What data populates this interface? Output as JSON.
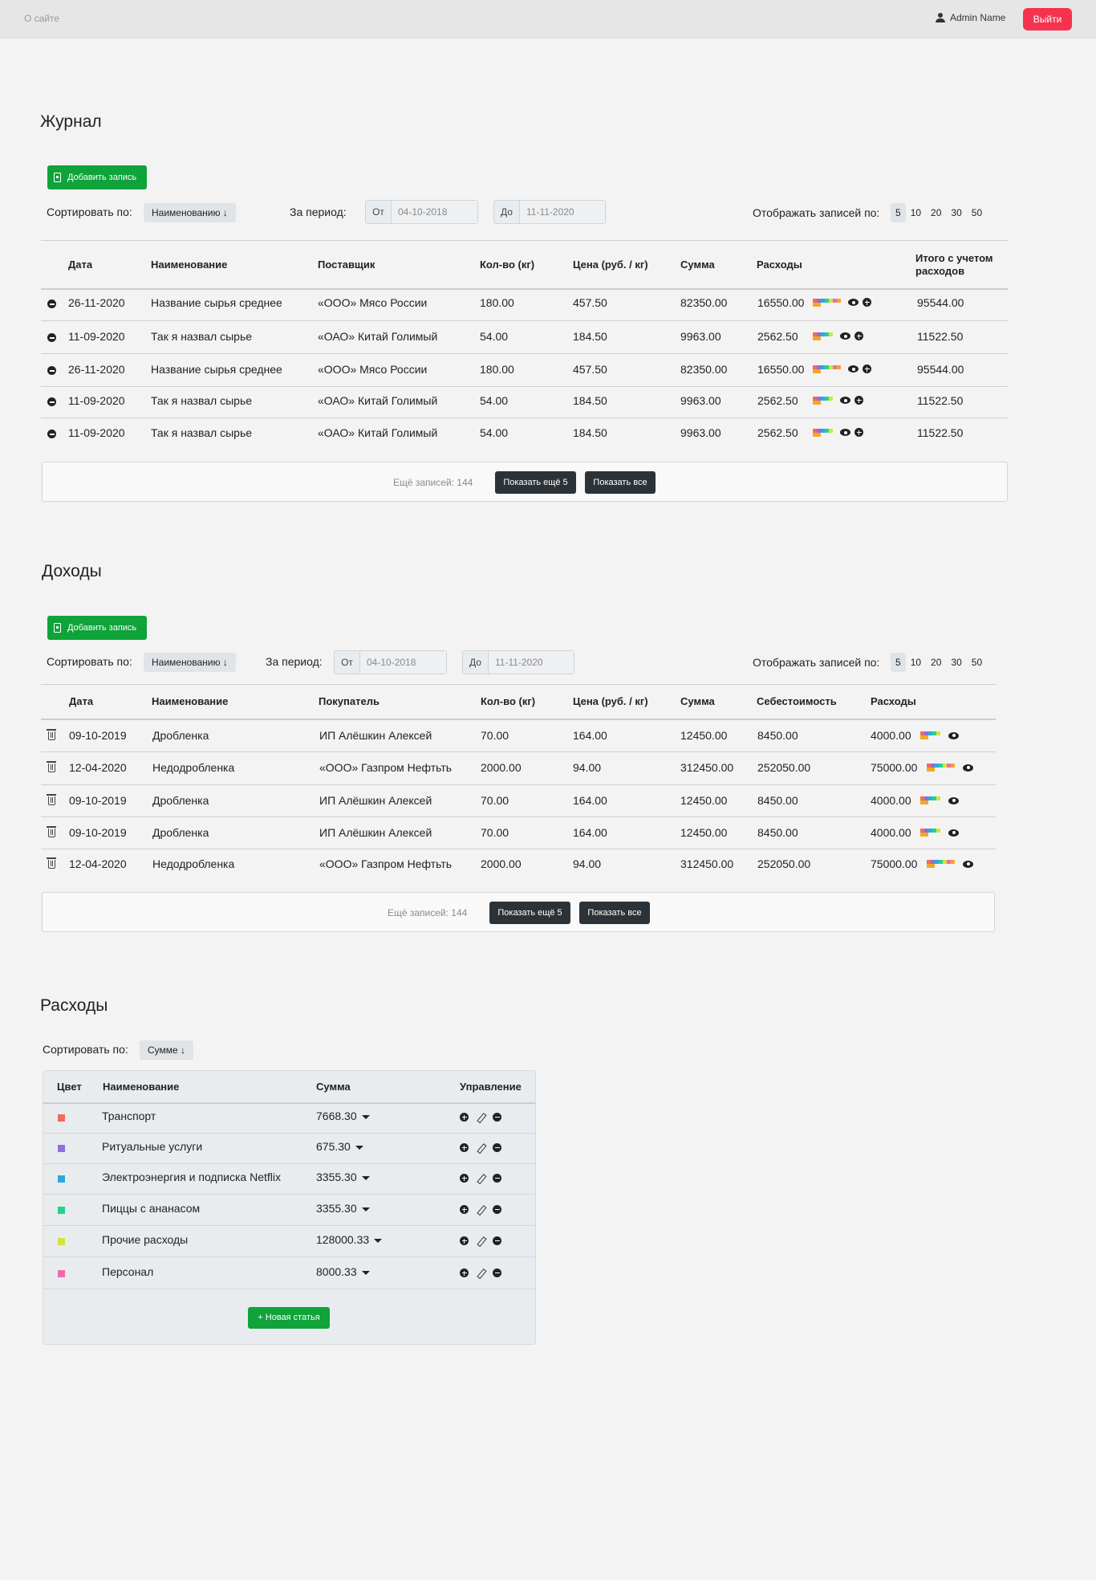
{
  "topbar": {
    "about": "О сайте",
    "user_name": "Admin Name",
    "logout": "Выйти"
  },
  "journal": {
    "title": "Журнал",
    "add_label": "Добавить запись",
    "sort_label": "Сортировать по:",
    "sort_value": "Наименованию ↓",
    "period_label": "За период:",
    "from_prefix": "От",
    "from_value": "04-10-2018",
    "to_prefix": "До",
    "to_value": "11-11-2020",
    "page_size_label": "Отображать записей по:",
    "page_sizes": [
      "5",
      "10",
      "20",
      "30",
      "50"
    ],
    "headers": [
      "Дата",
      "Наименование",
      "Поставщик",
      "Кол-во (кг)",
      "Цена (руб. / кг)",
      "Сумма",
      "Расходы",
      "Итого с учетом расходов"
    ],
    "rows": [
      {
        "date": "26-11-2020",
        "name": "Название сырья среднее",
        "supplier": "«ООО» Мясо России",
        "qty": "180.00",
        "price": "457.50",
        "sum": "82350.00",
        "expenses": "16550.00",
        "total": "95544.00"
      },
      {
        "date": "11-09-2020",
        "name": "Так я назвал сырье",
        "supplier": "«ОАО» Китай Голимый",
        "qty": "54.00",
        "price": "184.50",
        "sum": "9963.00",
        "expenses": "2562.50",
        "total": "11522.50"
      },
      {
        "date": "26-11-2020",
        "name": "Название сырья среднее",
        "supplier": "«ООО» Мясо России",
        "qty": "180.00",
        "price": "457.50",
        "sum": "82350.00",
        "expenses": "16550.00",
        "total": "95544.00"
      },
      {
        "date": "11-09-2020",
        "name": "Так я назвал сырье",
        "supplier": "«ОАО» Китай Голимый",
        "qty": "54.00",
        "price": "184.50",
        "sum": "9963.00",
        "expenses": "2562.50",
        "total": "11522.50"
      },
      {
        "date": "11-09-2020",
        "name": "Так я назвал сырье",
        "supplier": "«ОАО» Китай Голимый",
        "qty": "54.00",
        "price": "184.50",
        "sum": "9963.00",
        "expenses": "2562.50",
        "total": "11522.50"
      }
    ],
    "more_text": "Ещё записей: 144",
    "show_more": "Показать ещё 5",
    "show_all": "Показать все"
  },
  "income": {
    "title": "Доходы",
    "add_label": "Добавить запись",
    "sort_label": "Сортировать по:",
    "sort_value": "Наименованию ↓",
    "period_label": "За период:",
    "from_prefix": "От",
    "from_value": "04-10-2018",
    "to_prefix": "До",
    "to_value": "11-11-2020",
    "page_size_label": "Отображать записей по:",
    "page_sizes": [
      "5",
      "10",
      "20",
      "30",
      "50"
    ],
    "headers": [
      "Дата",
      "Наименование",
      "Покупатель",
      "Кол-во (кг)",
      "Цена (руб. / кг)",
      "Сумма",
      "Себестоимость",
      "Расходы"
    ],
    "rows": [
      {
        "date": "09-10-2019",
        "name": "Дробленка",
        "buyer": "ИП Алёшкин Алексей",
        "qty": "70.00",
        "price": "164.00",
        "sum": "12450.00",
        "cost": "8450.00",
        "expenses": "4000.00"
      },
      {
        "date": "12-04-2020",
        "name": "Недодробленка",
        "buyer": "«ООО» Газпром Нефтьть",
        "qty": "2000.00",
        "price": "94.00",
        "sum": "312450.00",
        "cost": "252050.00",
        "expenses": "75000.00"
      },
      {
        "date": "09-10-2019",
        "name": "Дробленка",
        "buyer": "ИП Алёшкин Алексей",
        "qty": "70.00",
        "price": "164.00",
        "sum": "12450.00",
        "cost": "8450.00",
        "expenses": "4000.00"
      },
      {
        "date": "09-10-2019",
        "name": "Дробленка",
        "buyer": "ИП Алёшкин Алексей",
        "qty": "70.00",
        "price": "164.00",
        "sum": "12450.00",
        "cost": "8450.00",
        "expenses": "4000.00"
      },
      {
        "date": "12-04-2020",
        "name": "Недодробленка",
        "buyer": "«ООО» Газпром Нефтьть",
        "qty": "2000.00",
        "price": "94.00",
        "sum": "312450.00",
        "cost": "252050.00",
        "expenses": "75000.00"
      }
    ],
    "more_text": "Ещё записей: 144",
    "show_more": "Показать ещё 5",
    "show_all": "Показать все"
  },
  "expenses": {
    "title": "Расходы",
    "sort_label": "Сортировать по:",
    "sort_value": "Сумме ↓",
    "headers": [
      "Цвет",
      "Наименование",
      "Сумма",
      "Управление"
    ],
    "rows": [
      {
        "color": "#f26b5b",
        "name": "Транспорт",
        "sum": "7668.30"
      },
      {
        "color": "#8c6fe0",
        "name": "Ритуальные услуги",
        "sum": "675.30"
      },
      {
        "color": "#2ea8dc",
        "name": "Электроэнергия и подписка Netflix",
        "sum": "3355.30"
      },
      {
        "color": "#22d48a",
        "name": "Пиццы с ананасом",
        "sum": "3355.30"
      },
      {
        "color": "#d6e23a",
        "name": "Прочие расходы",
        "sum": "128000.33"
      },
      {
        "color": "#f06ab0",
        "name": "Персонал",
        "sum": "8000.33"
      }
    ],
    "new_item": "+ Новая статья"
  },
  "palette": [
    "#f26b5b",
    "#8c6fe0",
    "#2ea8dc",
    "#22d48a",
    "#d6e23a",
    "#f06ab0",
    "#f5a623"
  ]
}
